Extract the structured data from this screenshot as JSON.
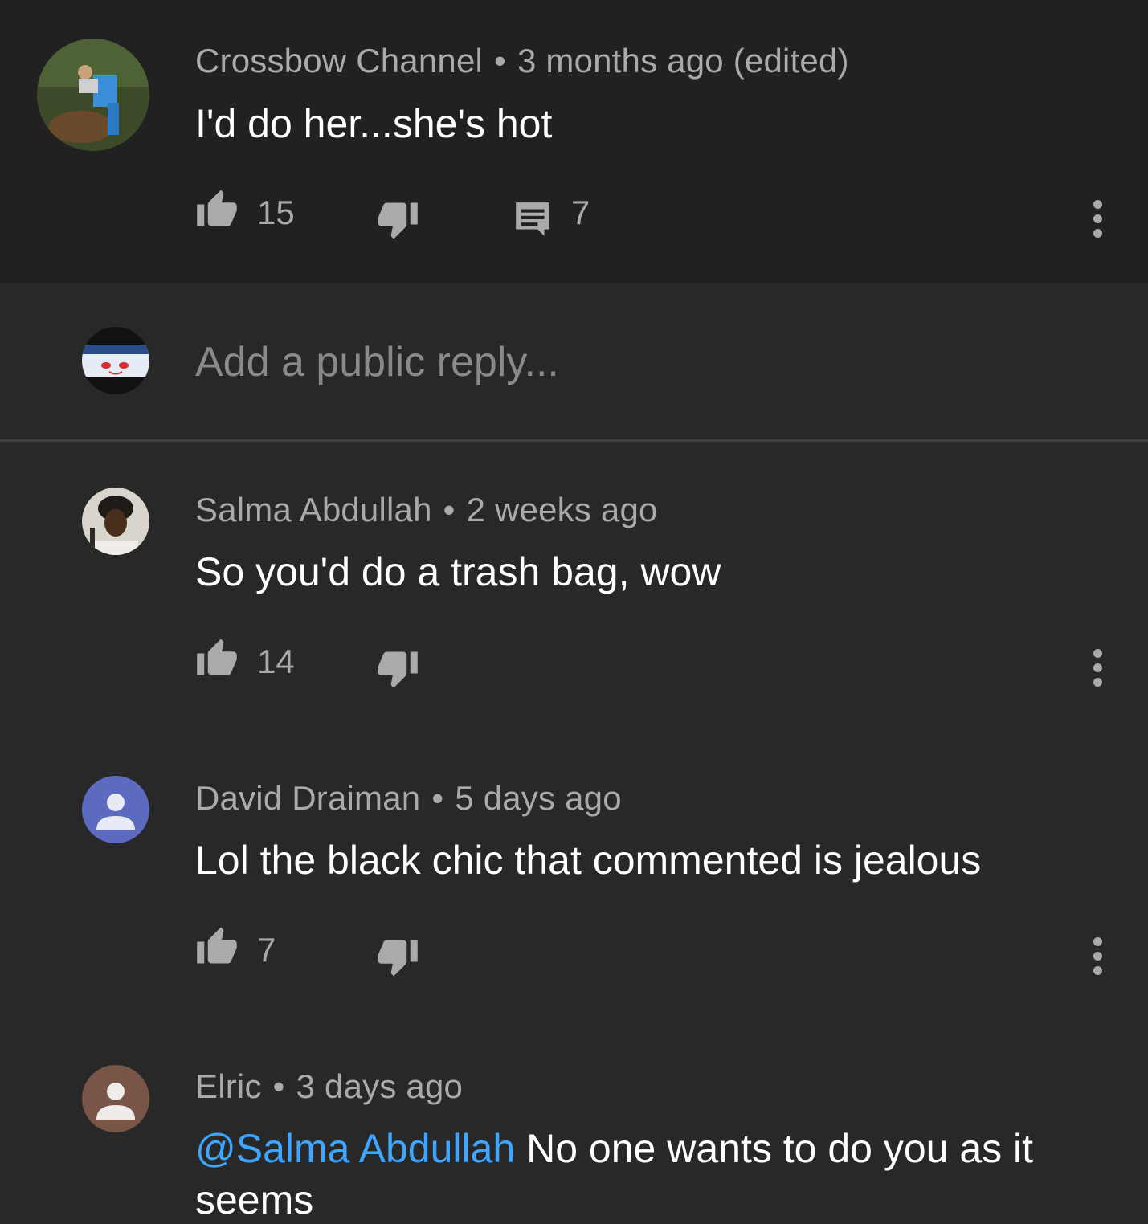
{
  "parent": {
    "author": "Crossbow Channel",
    "time": "3 months ago (edited)",
    "text": "I'd do her...she's hot",
    "likes": "15",
    "replies": "7"
  },
  "reply_box": {
    "placeholder": "Add a public reply..."
  },
  "comments": [
    {
      "author": "Salma Abdullah",
      "time": "2 weeks ago",
      "text": "So you'd do a trash bag, wow",
      "likes": "14"
    },
    {
      "author": "David Draiman",
      "time": "5 days ago",
      "text": "Lol the black chic that commented is jealous",
      "likes": "7"
    },
    {
      "author": "Elric",
      "time": "3 days ago",
      "mention": "@Salma Abdullah",
      "text": " No one wants to do you as it seems"
    }
  ],
  "separator": "•",
  "colors": {
    "background": "#282828",
    "parent_background": "#212121",
    "meta_text": "#aaaaaa",
    "body_text": "#ffffff",
    "mention": "#3ea6ff",
    "avatar_purple": "#5c6bc0",
    "avatar_brown": "#795548"
  },
  "icons": [
    "thumb-up-icon",
    "thumb-down-icon",
    "reply-comment-icon",
    "more-vert-icon",
    "default-avatar-icon"
  ]
}
